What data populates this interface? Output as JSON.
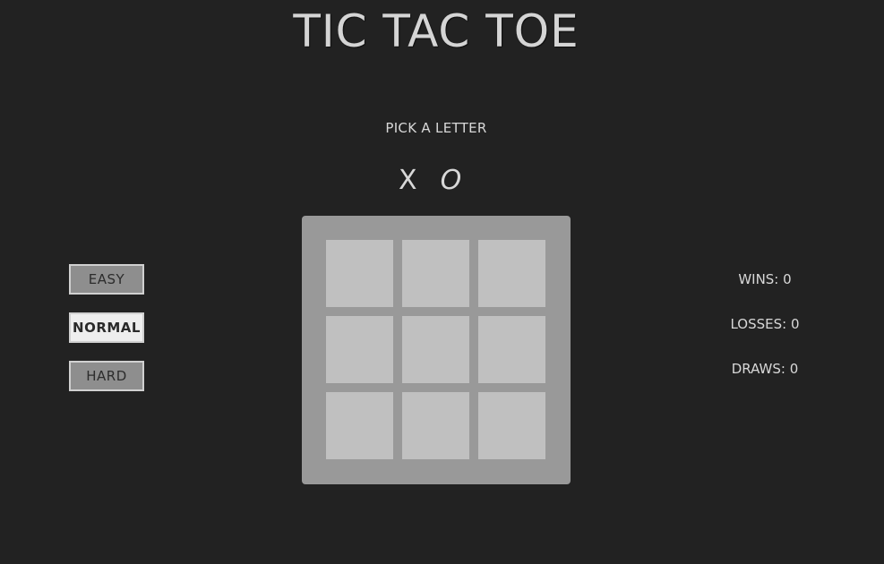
{
  "title": "TIC TAC TOE",
  "pick_label": "PICK A LETTER",
  "letters": [
    "X",
    "O"
  ],
  "difficulty": {
    "options": [
      "EASY",
      "NORMAL",
      "HARD"
    ],
    "selected": "NORMAL"
  },
  "board": {
    "cells": [
      "",
      "",
      "",
      "",
      "",
      "",
      "",
      "",
      ""
    ]
  },
  "stats": {
    "wins": "WINS: 0",
    "losses": "LOSSES: 0",
    "draws": "DRAWS: 0"
  },
  "colors": {
    "background": "#222222",
    "board": "#999999",
    "cell": "#c0c0c0",
    "text": "#d8d8d8",
    "selected_button": "#eeeeee",
    "button": "#8e8e8e"
  }
}
